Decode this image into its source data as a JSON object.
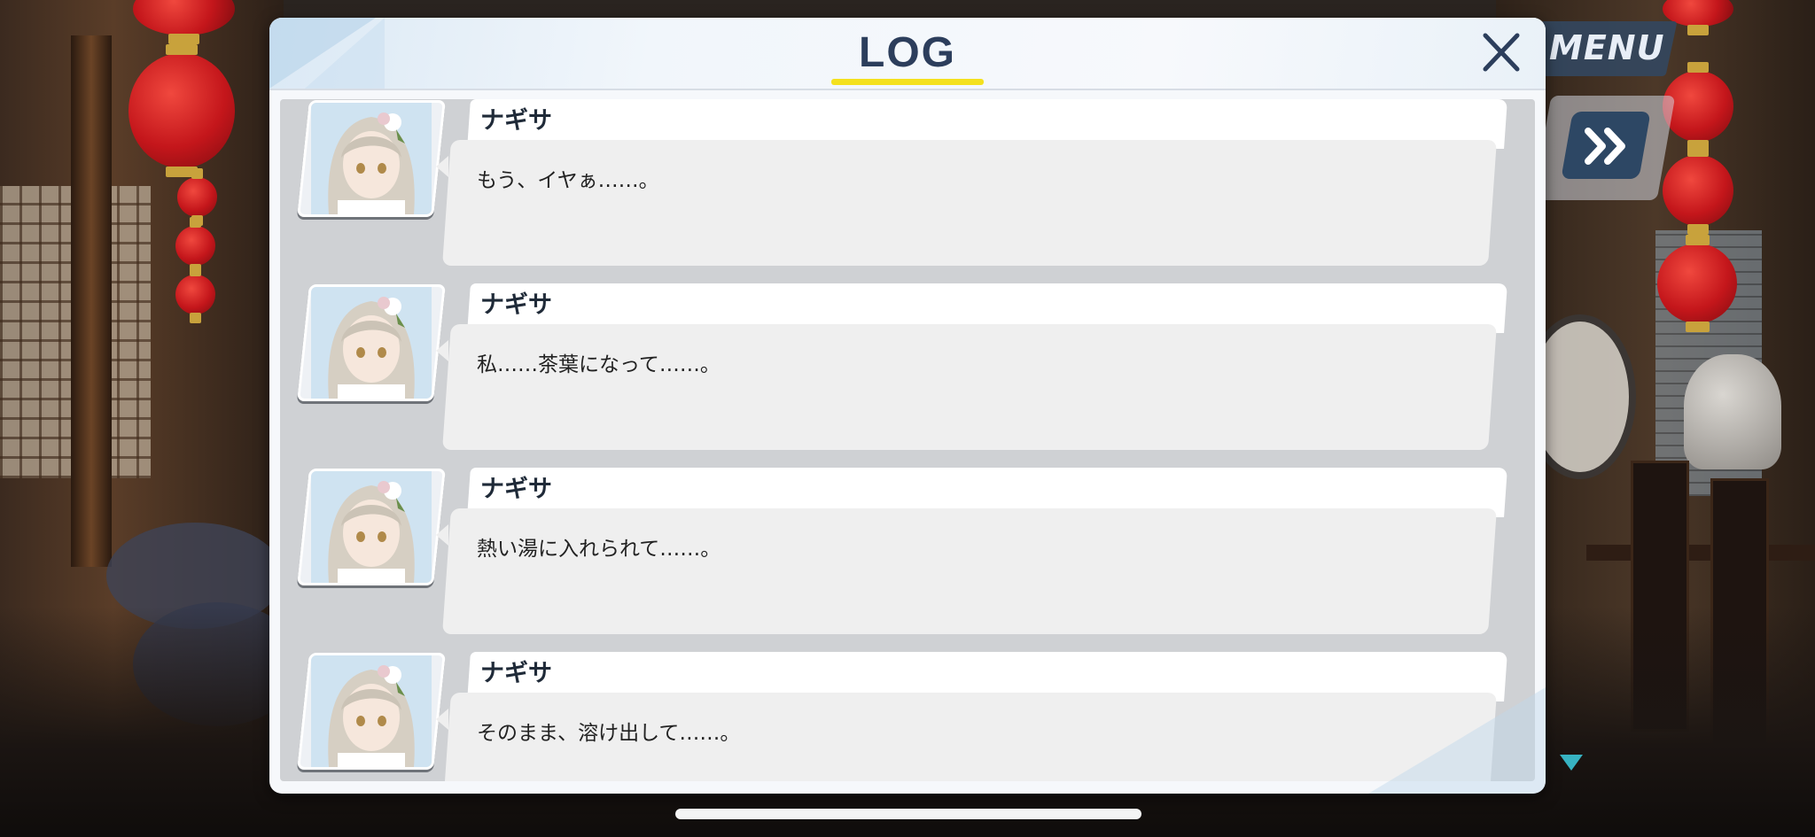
{
  "header": {
    "menu_label": "MENU",
    "title": "LOG"
  },
  "controls": {
    "fast_forward_icon": "double-chevron-right-icon",
    "close_icon": "close-icon",
    "next_indicator_icon": "triangle-down-icon"
  },
  "log": {
    "entries": [
      {
        "speaker": "ナギサ",
        "message": "もう、イヤぁ……。"
      },
      {
        "speaker": "ナギサ",
        "message": "私……茶葉になって……。"
      },
      {
        "speaker": "ナギサ",
        "message": "熱い湯に入れられて……。"
      },
      {
        "speaker": "ナギサ",
        "message": "そのまま、溶け出して……。"
      }
    ]
  },
  "colors": {
    "title_text": "#2c3e5c",
    "title_underline": "#f4e11f",
    "menu_button": "#33475f",
    "fast_forward_button": "#2d4764",
    "next_indicator": "#37b3c2"
  }
}
